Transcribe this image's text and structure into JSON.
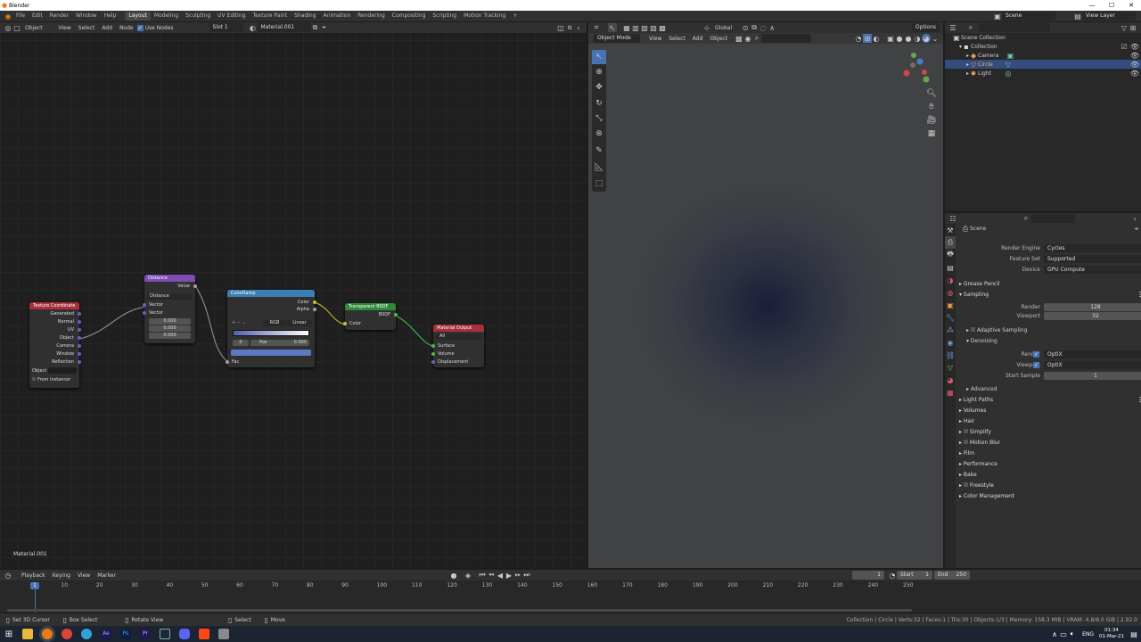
{
  "window": {
    "title": "Blender"
  },
  "menu": {
    "items": [
      "File",
      "Edit",
      "Render",
      "Window",
      "Help"
    ],
    "workspaces": [
      "Layout",
      "Modeling",
      "Sculpting",
      "UV Editing",
      "Texture Paint",
      "Shading",
      "Animation",
      "Rendering",
      "Compositing",
      "Scripting",
      "Motion Tracking"
    ],
    "active_workspace": "Layout",
    "add_tab": "+"
  },
  "topright": {
    "scene": "Scene",
    "view_layer": "View Layer"
  },
  "node_editor": {
    "header": {
      "mode": "Object",
      "view": "View",
      "select": "Select",
      "add": "Add",
      "node": "Node",
      "use_nodes": "Use Nodes",
      "slot": "Slot 1",
      "material": "Material.001"
    },
    "material_label": "Material.001",
    "nodes": {
      "texcoord": {
        "title": "Texture Coordinate",
        "outputs": [
          "Generated",
          "Normal",
          "UV",
          "Object",
          "Camera",
          "Window",
          "Reflection"
        ],
        "object_label": "Object",
        "from_instancer": "From Instancer",
        "color": "#a8303a"
      },
      "distance": {
        "title": "Distance",
        "output": "Value",
        "mode": "Distance",
        "inputs": [
          "Vector",
          "Vector"
        ],
        "values": [
          "0.000",
          "0.000",
          "0.000"
        ],
        "color": "#7f4cb3"
      },
      "colorramp": {
        "title": "ColorRamp",
        "outputs": [
          "Color",
          "Alpha"
        ],
        "mode": "RGB",
        "interp": "Linear",
        "index": "0",
        "pos_label": "Pos",
        "pos": "0.000",
        "input": "Fac",
        "color": "#3c7fb3"
      },
      "transparent": {
        "title": "Transparent BSDF",
        "output": "BSDF",
        "input": "Color",
        "color": "#2f8a3a"
      },
      "output": {
        "title": "Material Output",
        "target": "All",
        "inputs": [
          "Surface",
          "Volume",
          "Displacement"
        ],
        "color": "#a8303a"
      }
    }
  },
  "viewport": {
    "header": {
      "mode": "Object Mode",
      "view": "View",
      "select": "Select",
      "add": "Add",
      "object": "Object",
      "orientation": "Global",
      "options": "Options"
    }
  },
  "outliner": {
    "title": "Scene Collection",
    "items": [
      {
        "name": "Collection"
      },
      {
        "name": "Camera"
      },
      {
        "name": "Circle"
      },
      {
        "name": "Light"
      }
    ]
  },
  "properties": {
    "context": "Scene",
    "render_engine_label": "Render Engine",
    "render_engine": "Cycles",
    "feature_set_label": "Feature Set",
    "feature_set": "Supported",
    "device_label": "Device",
    "device": "GPU Compute",
    "grease_pencil": "Grease Pencil",
    "sampling": "Sampling",
    "render_label": "Render",
    "render_samples": "128",
    "viewport_label": "Viewport",
    "viewport_samples": "32",
    "adaptive": "Adaptive Sampling",
    "denoising": "Denoising",
    "den_render_label": "Render",
    "den_render": "OptiX",
    "den_viewport_label": "Viewport",
    "den_viewport": "OptiX",
    "start_sample_label": "Start Sample",
    "start_sample": "1",
    "advanced": "Advanced",
    "sections": [
      "Light Paths",
      "Volumes",
      "Hair",
      "Simplify",
      "Motion Blur",
      "Film",
      "Performance",
      "Bake",
      "Freestyle",
      "Color Management"
    ]
  },
  "timeline": {
    "playback": "Playback",
    "keying": "Keying",
    "view": "View",
    "marker": "Marker",
    "current": "1",
    "start_label": "Start",
    "start": "1",
    "end_label": "End",
    "end": "250",
    "ticks": [
      "1",
      "10",
      "20",
      "30",
      "40",
      "50",
      "60",
      "70",
      "80",
      "90",
      "100",
      "110",
      "120",
      "130",
      "140",
      "150",
      "160",
      "170",
      "180",
      "190",
      "200",
      "210",
      "220",
      "230",
      "240",
      "250"
    ]
  },
  "status": {
    "left": [
      "Set 3D Cursor",
      "Box Select",
      "Rotate View",
      "Select",
      "Move"
    ],
    "right": "Collection | Circle | Verts:32 | Faces:1 | Tris:30 | Objects:1/3 | Memory: 158.3 MiB | VRAM: 4.8/8.0 GiB | 2.92.0"
  },
  "taskbar": {
    "lang": "ENG",
    "time": "01:34",
    "date": "01-Mar-21"
  }
}
